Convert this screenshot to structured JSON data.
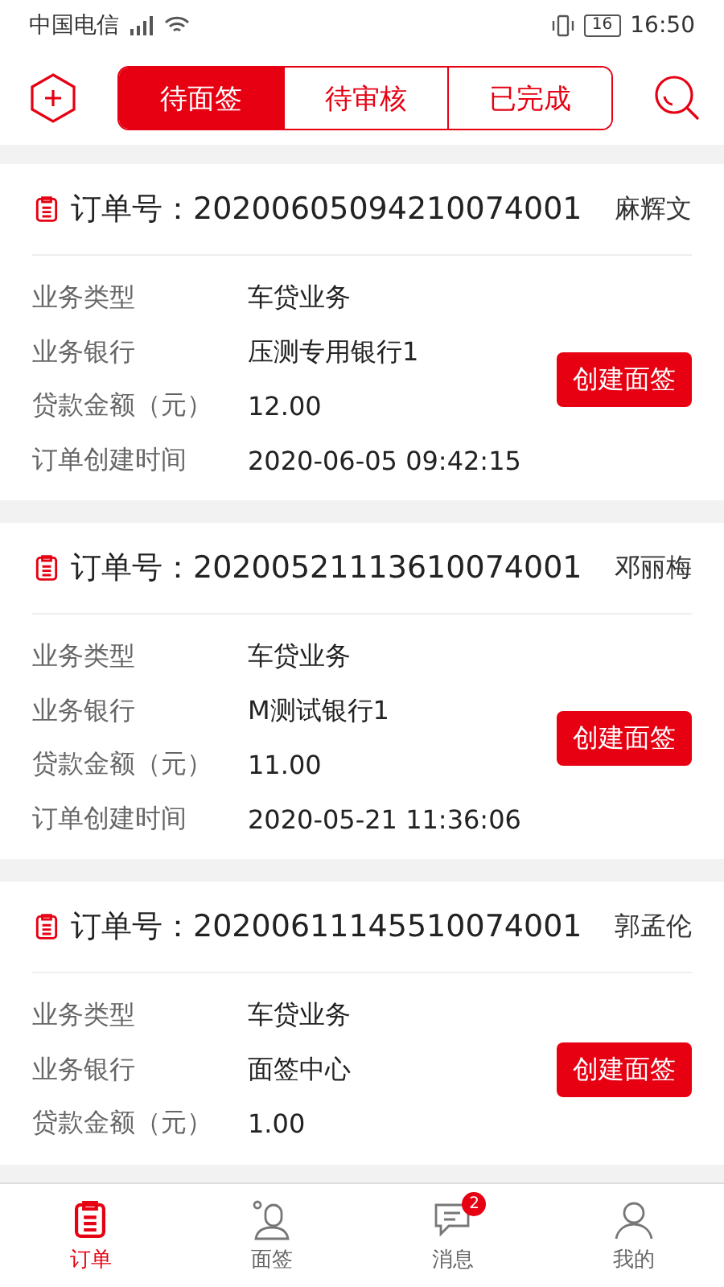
{
  "status_bar": {
    "carrier": "中国电信",
    "battery": "16",
    "time": "16:50"
  },
  "header": {
    "tabs": [
      {
        "label": "待面签",
        "selected": true
      },
      {
        "label": "待审核",
        "selected": false
      },
      {
        "label": "已完成",
        "selected": false
      }
    ]
  },
  "orders": [
    {
      "number_label": "订单号：",
      "number": "20200605094210074001",
      "customer": "麻辉文",
      "fields": [
        {
          "label": "业务类型",
          "value": "车贷业务"
        },
        {
          "label": "业务银行",
          "value": "压测专用银行1"
        },
        {
          "label": "贷款金额（元）",
          "value": "12.00"
        },
        {
          "label": "订单创建时间",
          "value": "2020-06-05 09:42:15"
        }
      ],
      "action": "创建面签"
    },
    {
      "number_label": "订单号：",
      "number": "20200521113610074001",
      "customer": "邓丽梅",
      "fields": [
        {
          "label": "业务类型",
          "value": "车贷业务"
        },
        {
          "label": "业务银行",
          "value": "M测试银行1"
        },
        {
          "label": "贷款金额（元）",
          "value": "11.00"
        },
        {
          "label": "订单创建时间",
          "value": "2020-05-21 11:36:06"
        }
      ],
      "action": "创建面签"
    },
    {
      "number_label": "订单号：",
      "number": "20200611145510074001",
      "customer": "郭孟伦",
      "fields": [
        {
          "label": "业务类型",
          "value": "车贷业务"
        },
        {
          "label": "业务银行",
          "value": "面签中心"
        },
        {
          "label": "贷款金额（元）",
          "value": "1.00"
        }
      ],
      "action": "创建面签"
    }
  ],
  "bottom_nav": [
    {
      "label": "订单",
      "kind": "clipboard",
      "selected": true
    },
    {
      "label": "面签",
      "kind": "facesign",
      "selected": false
    },
    {
      "label": "消息",
      "kind": "message",
      "selected": false,
      "badge": "2"
    },
    {
      "label": "我的",
      "kind": "profile",
      "selected": false
    }
  ]
}
